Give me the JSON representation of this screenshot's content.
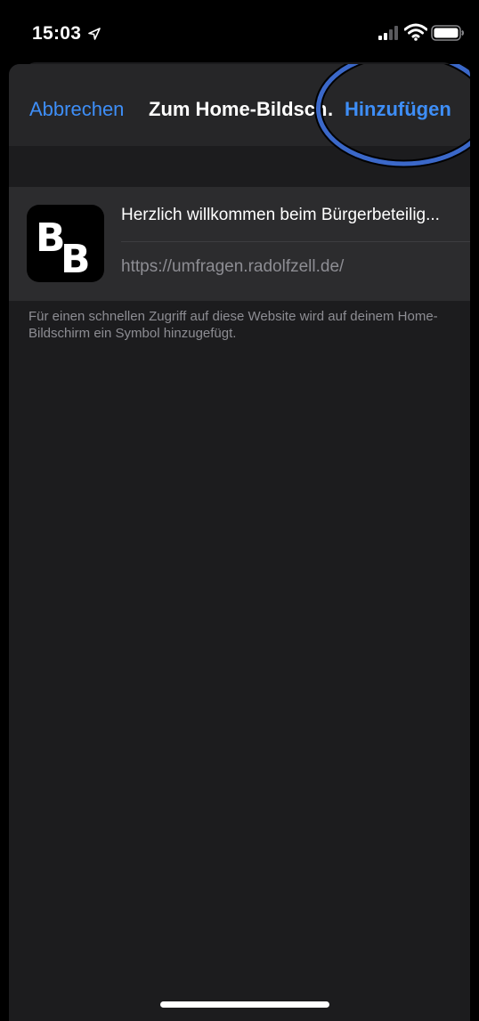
{
  "status_bar": {
    "time": "15:03",
    "icons": [
      "location-arrow-icon",
      "cellular-signal-icon",
      "wifi-icon",
      "battery-icon"
    ]
  },
  "nav": {
    "cancel_label": "Abbrechen",
    "title": "Zum Home-Bildschirm",
    "add_label": "Hinzufügen"
  },
  "bookmark": {
    "icon_letters": "BB",
    "title": "Herzlich willkommen beim Bürgerbeteilig...",
    "url": "https://umfragen.radolfzell.de/"
  },
  "footer": {
    "text": "Für einen schnellen Zugriff auf diese Website wird auf deinem Home-Bildschirm ein Symbol hinzugefügt."
  },
  "colors": {
    "accent": "#3e8ef7",
    "highlight_circle": "#3b68c9",
    "sheet_bg": "#1c1c1e",
    "cell_bg": "#2c2c2e"
  }
}
